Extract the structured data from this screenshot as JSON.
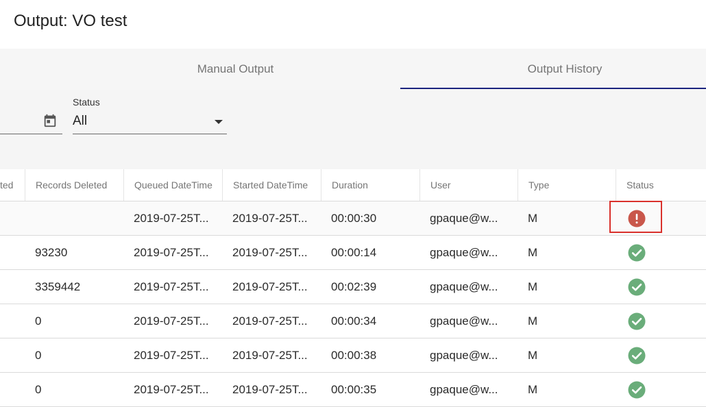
{
  "page": {
    "title": "Output: VO test"
  },
  "tabs": [
    {
      "label": "Manual Output",
      "active": false
    },
    {
      "label": "Output History",
      "active": true
    }
  ],
  "filters": {
    "date_icon": "calendar-icon",
    "status": {
      "label": "Status",
      "value": "All"
    }
  },
  "table": {
    "columns": [
      "ted",
      "Records Deleted",
      "Queued DateTime",
      "Started DateTime",
      "Duration",
      "User",
      "Type",
      "Status"
    ],
    "rows": [
      {
        "records_deleted": "",
        "queued": "2019-07-25T...",
        "started": "2019-07-25T...",
        "duration": "00:00:30",
        "user": "gpaque@w...",
        "type": "M",
        "status": "error"
      },
      {
        "records_deleted": "93230",
        "queued": "2019-07-25T...",
        "started": "2019-07-25T...",
        "duration": "00:00:14",
        "user": "gpaque@w...",
        "type": "M",
        "status": "success"
      },
      {
        "records_deleted": "3359442",
        "queued": "2019-07-25T...",
        "started": "2019-07-25T...",
        "duration": "00:02:39",
        "user": "gpaque@w...",
        "type": "M",
        "status": "success"
      },
      {
        "records_deleted": "0",
        "queued": "2019-07-25T...",
        "started": "2019-07-25T...",
        "duration": "00:00:34",
        "user": "gpaque@w...",
        "type": "M",
        "status": "success"
      },
      {
        "records_deleted": "0",
        "queued": "2019-07-25T...",
        "started": "2019-07-25T...",
        "duration": "00:00:38",
        "user": "gpaque@w...",
        "type": "M",
        "status": "success"
      },
      {
        "records_deleted": "0",
        "queued": "2019-07-25T...",
        "started": "2019-07-25T...",
        "duration": "00:00:35",
        "user": "gpaque@w...",
        "type": "M",
        "status": "success"
      }
    ]
  },
  "colors": {
    "success": "#6aad7a",
    "error": "#c9574b",
    "tab_indicator": "#1a237e",
    "highlight": "#d9302b"
  }
}
